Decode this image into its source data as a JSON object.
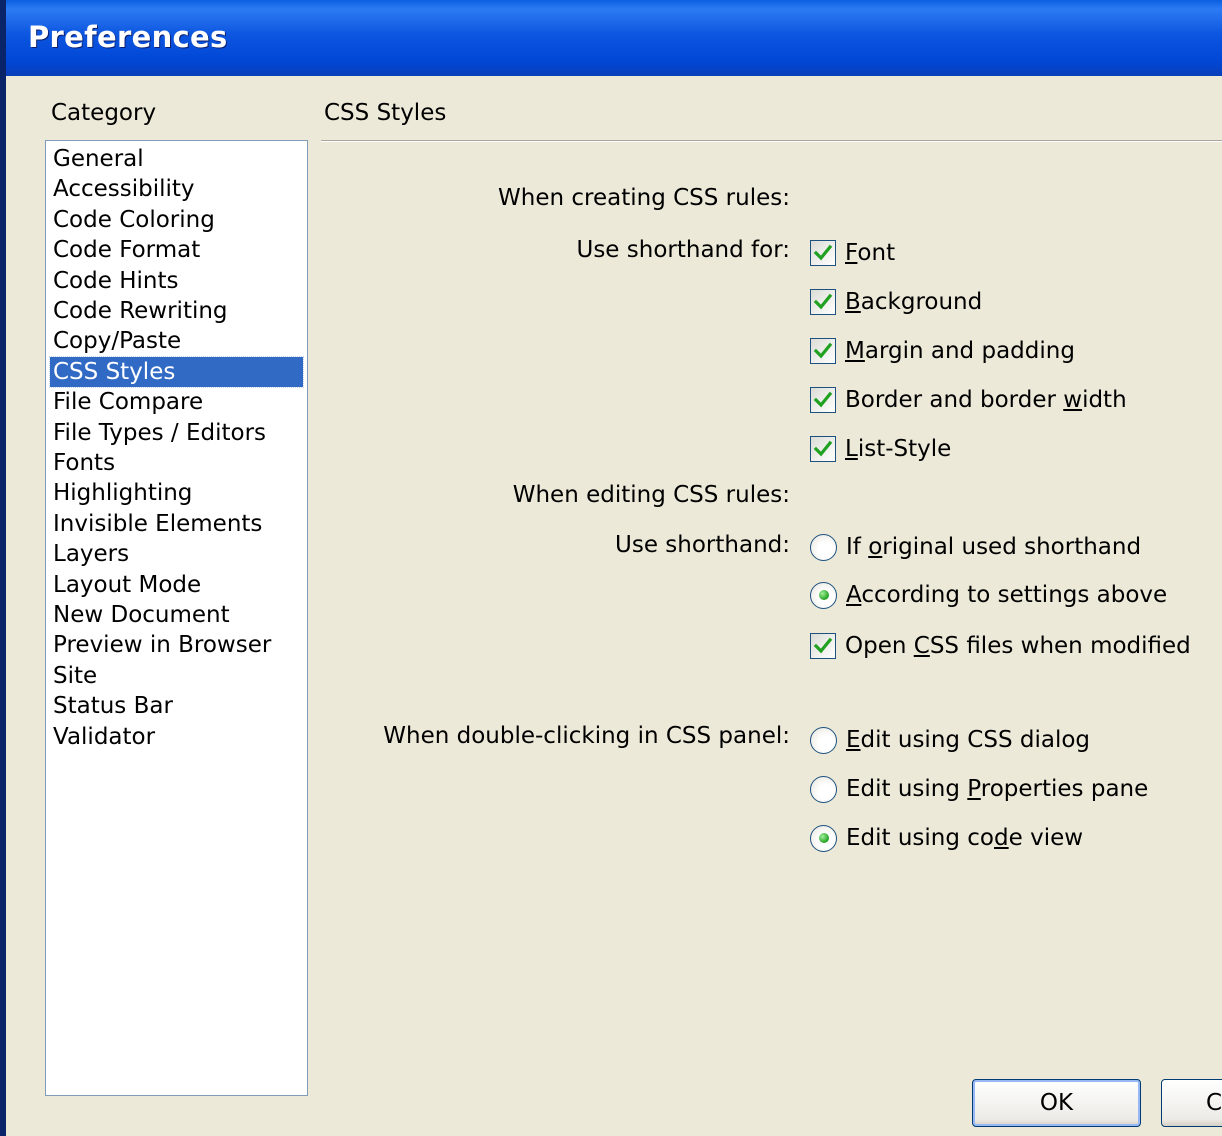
{
  "window": {
    "title": "Preferences"
  },
  "category": {
    "label": "Category",
    "items": [
      "General",
      "Accessibility",
      "Code Coloring",
      "Code Format",
      "Code Hints",
      "Code Rewriting",
      "Copy/Paste",
      "CSS Styles",
      "File Compare",
      "File Types / Editors",
      "Fonts",
      "Highlighting",
      "Invisible Elements",
      "Layers",
      "Layout Mode",
      "New Document",
      "Preview in Browser",
      "Site",
      "Status Bar",
      "Validator"
    ],
    "selected": "CSS Styles"
  },
  "panel": {
    "title": "CSS Styles",
    "creating_label": "When creating CSS rules:",
    "shorthand_for_label": "Use shorthand for:",
    "shorthand_options": [
      {
        "pre": "",
        "key": "F",
        "post": "ont",
        "checked": true
      },
      {
        "pre": "",
        "key": "B",
        "post": "ackground",
        "checked": true
      },
      {
        "pre": "",
        "key": "M",
        "post": "argin and padding",
        "checked": true
      },
      {
        "pre": "Border and border ",
        "key": "w",
        "post": "idth",
        "checked": true
      },
      {
        "pre": "",
        "key": "L",
        "post": "ist-Style",
        "checked": true
      }
    ],
    "editing_label": "When editing CSS rules:",
    "use_shorthand_label": "Use shorthand:",
    "edit_options": [
      {
        "pre": "If ",
        "key": "o",
        "post": "riginal used shorthand",
        "selected": false
      },
      {
        "pre": "",
        "key": "A",
        "post": "ccording to settings above",
        "selected": true
      }
    ],
    "open_css": {
      "pre": "Open ",
      "key": "C",
      "post": "SS files when modified",
      "checked": true
    },
    "doubleclick_label": "When double-clicking in CSS panel:",
    "doubleclick_options": [
      {
        "pre": "",
        "key": "E",
        "post": "dit using CSS dialog",
        "selected": false
      },
      {
        "pre": "Edit using ",
        "key": "P",
        "post": "roperties pane",
        "selected": false
      },
      {
        "pre": "Edit using co",
        "key": "d",
        "post": "e view",
        "selected": true
      }
    ]
  },
  "buttons": {
    "ok": "OK",
    "cancel_partial": "Ca"
  }
}
